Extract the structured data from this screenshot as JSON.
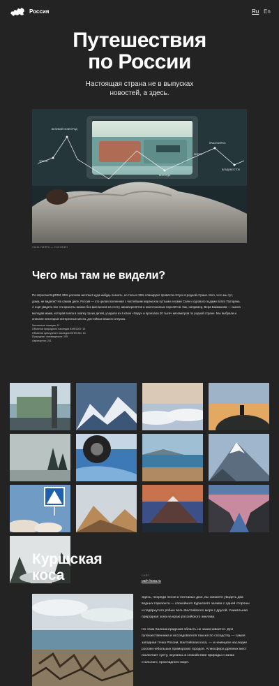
{
  "header": {
    "site_name": "Россия",
    "lang_ru": "Ru",
    "lang_en": "En"
  },
  "hero": {
    "title_line1": "Путешествия",
    "title_line2": "по России",
    "subtitle": "Настоящая страна не в выпусках новостей, а здесь.",
    "photo_labels": [
      "ВЕЛИКИЙ НОВГОРОД",
      "ТОСНО",
      "ВОЛОГДА",
      "КИРОВ",
      "КРАСНОЯРСК",
      "ВЛАДИВОСТОК"
    ],
    "caption": "ЛАНА ПИЯРА — УСЛУЖЕН"
  },
  "section1": {
    "title": "Чего мы там не видели?",
    "body": "По опросам ВЦИОМ, 85% россиян мечтают куда-нибудь поехать, но только 26% планируют провести отпуск в родной стране. Мол, чего мы тут, дома, не видели? На самом деле, Россия — это целая вселенная с чистейшим морем или густыми лесами Саян и сурового льдами плато Путорана. А ещё увидеть все эти красоты можно без миллионов на счету, авиаперелётов и многочасовых перелётов. Как, например, Вера Бакмакова — сшила молодая мама, которая взяла в охапку троих детей, усадила их в свою «Ладу» и проехала 20 тысяч километров по родной стране. Мы выбрали и описали некоторые интересные места, достойные вашего отпуска.",
    "stats": [
      "Численные локации: 11",
      "Объектов природного наследия ЮНЕСКО: 10",
      "Объектов культурного наследия ЮНЕСКО: 14",
      "Природных заповедников: 105",
      "Аэропортов: 241"
    ]
  },
  "gallery": [
    {
      "name": "train-window-photo"
    },
    {
      "name": "mountain-aerial-photo"
    },
    {
      "name": "clouds-sunset-photo"
    },
    {
      "name": "hill-silhouette-photo"
    },
    {
      "name": "foggy-forest-photo"
    },
    {
      "name": "ice-wheel-photo"
    },
    {
      "name": "lake-shore-photo"
    },
    {
      "name": "snowy-peak-photo"
    },
    {
      "name": "road-sign-photo"
    },
    {
      "name": "autumn-mountains-photo"
    },
    {
      "name": "volcano-photo"
    },
    {
      "name": "canyon-photo"
    },
    {
      "name": "misty-rocks-photo"
    }
  ],
  "section2": {
    "title_line1": "Куршская",
    "title_line2": "коса",
    "site_label": "САЙТ",
    "site_link": "park-kosa.ru",
    "paragraph1": "Здесь, посреди лесов и песчаных дюн, вы сможете увидеть два водных горизонта — спокойного Куршского залива с одной стороны и подёрнутого рябью волн Балтийского моря с другой. Уникальная природная зона на краю российского анклава.",
    "paragraph2": "Но этим Калининградская область не заканчивается. Для путешественника и исследователя там же по соседству — самая западная точка России, Балтийская коса, — и немецкое наследие россии небольших приморских городов. Атмосфера древних мест исключает суету, окунаясь в спокойствие природы и запах стального, прохладного моря."
  },
  "colors": {
    "background": "#232323",
    "text": "#ffffff"
  }
}
